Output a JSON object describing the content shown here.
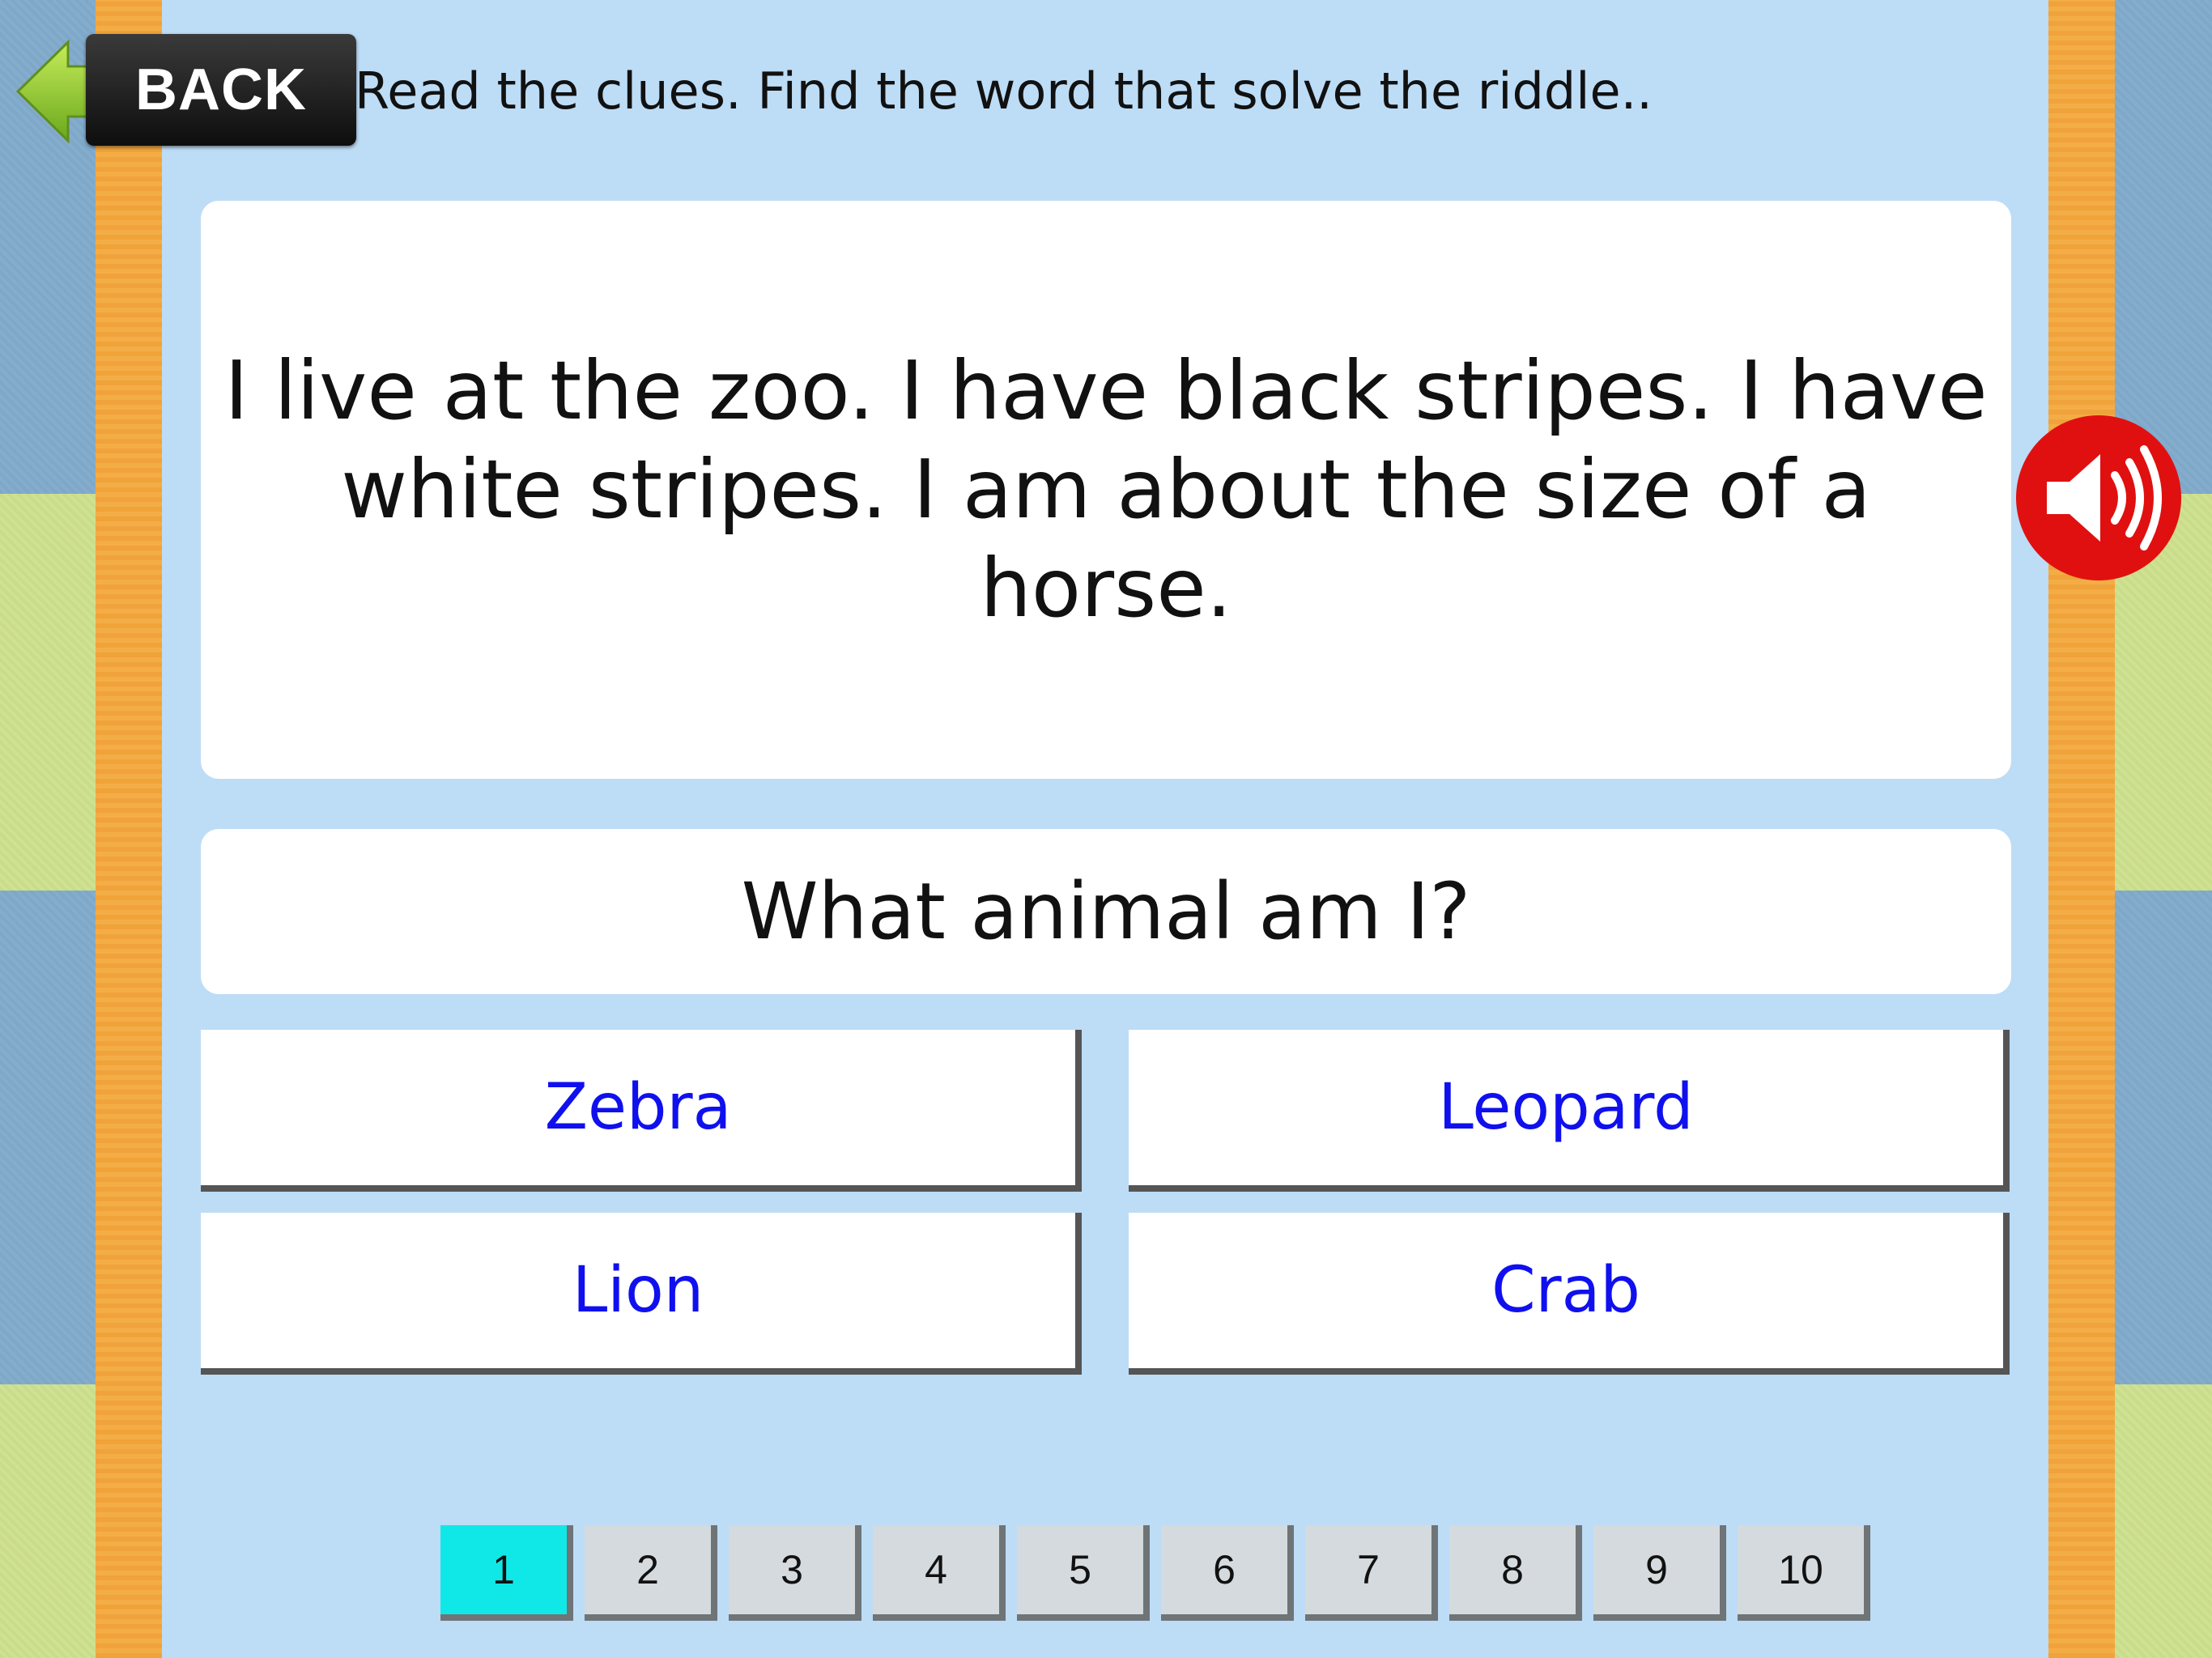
{
  "header": {
    "back_label": "BACK",
    "instruction": "Read the clues. Find the word that solve the riddle.."
  },
  "riddle": {
    "text": "I live at the zoo. I have black stripes. I have white stripes. I am about the size of a horse."
  },
  "question": {
    "text": "What animal am I?"
  },
  "answers": [
    {
      "label": "Zebra"
    },
    {
      "label": "Leopard"
    },
    {
      "label": "Lion"
    },
    {
      "label": "Crab"
    }
  ],
  "pager": {
    "pages": [
      "1",
      "2",
      "3",
      "4",
      "5",
      "6",
      "7",
      "8",
      "9",
      "10"
    ],
    "current": "1"
  },
  "colors": {
    "answer_text": "#1010ee",
    "active_page": "#10e8e8",
    "sound_button": "#e01010",
    "panel": "#bddcf6",
    "frame": "#f0a33a"
  },
  "icons": {
    "back": "green-left-arrow-icon",
    "sound": "speaker-icon"
  }
}
